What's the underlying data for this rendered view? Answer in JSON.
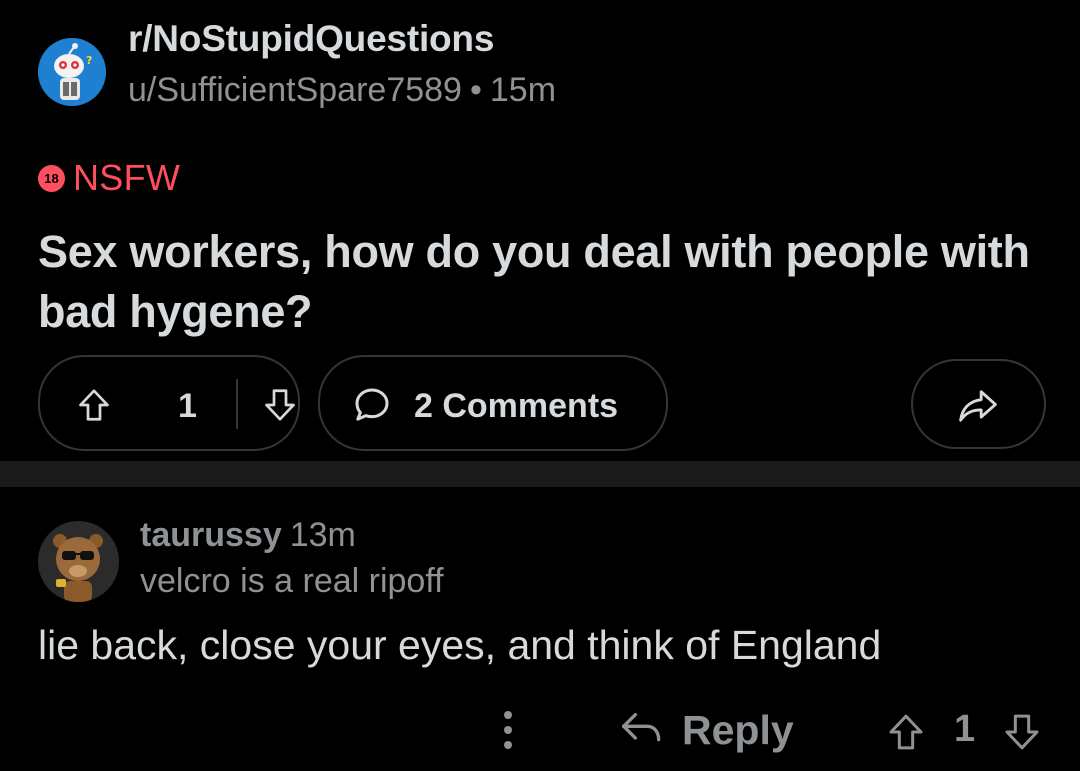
{
  "post": {
    "subreddit": "r/NoStupidQuestions",
    "author": "u/SufficientSpare7589",
    "separator": "•",
    "age": "15m",
    "nsfw_badge": "18",
    "nsfw_label": "NSFW",
    "title": "Sex workers, how do you deal with people with bad hygene?",
    "score": "1",
    "comments_label": "2 Comments"
  },
  "comment": {
    "username": "taurussy",
    "age": "13m",
    "flair": "velcro is a real ripoff",
    "body": "lie back, close your eyes, and think of England",
    "reply_label": "Reply",
    "score": "1"
  },
  "icons": {
    "subreddit_avatar": "subreddit-avatar-icon",
    "upvote": "upvote-arrow-icon",
    "downvote": "downvote-arrow-icon",
    "comments": "speech-bubble-icon",
    "share": "share-arrow-icon",
    "more": "vertical-dots-icon",
    "reply": "reply-arrow-icon"
  },
  "colors": {
    "background": "#000000",
    "separator": "#1a1a1b",
    "border": "#343536",
    "text_primary": "#d7dadc",
    "text_secondary": "#8e9295",
    "nsfw": "#ff4f5e",
    "subreddit_avatar_bg": "#1f7fd0"
  }
}
